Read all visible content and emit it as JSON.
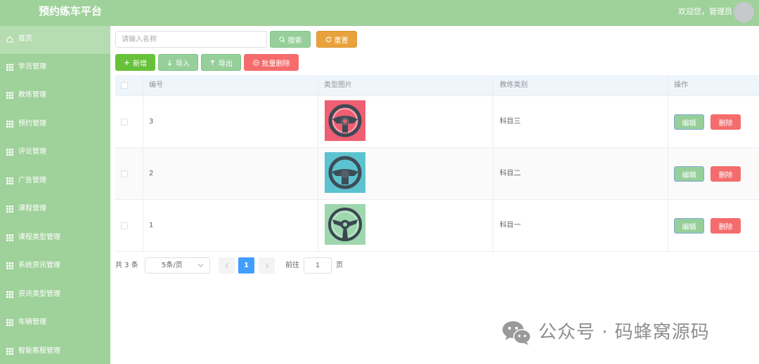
{
  "header": {
    "brand": "预约练车平台",
    "welcome": "欢迎您，管理员"
  },
  "sidebar": {
    "items": [
      {
        "label": "首页",
        "icon": "home-icon"
      },
      {
        "label": "学员管理",
        "icon": "grid-icon"
      },
      {
        "label": "教练管理",
        "icon": "grid-icon"
      },
      {
        "label": "预约管理",
        "icon": "grid-icon"
      },
      {
        "label": "评论管理",
        "icon": "grid-icon"
      },
      {
        "label": "广告管理",
        "icon": "grid-icon"
      },
      {
        "label": "课程管理",
        "icon": "grid-icon"
      },
      {
        "label": "课程类型管理",
        "icon": "grid-icon"
      },
      {
        "label": "系统资讯管理",
        "icon": "grid-icon"
      },
      {
        "label": "资讯类型管理",
        "icon": "grid-icon"
      },
      {
        "label": "车辆管理",
        "icon": "grid-icon"
      },
      {
        "label": "智能客服管理",
        "icon": "grid-icon"
      }
    ]
  },
  "toolbar": {
    "search_placeholder": "请输入名称",
    "search_label": "搜索",
    "reset_label": "重置",
    "add_label": "新增",
    "import_label": "导入",
    "export_label": "导出",
    "batch_delete_label": "批量删除"
  },
  "table": {
    "headers": {
      "number": "编号",
      "image": "类型图片",
      "category": "教练类别",
      "actions": "操作"
    },
    "rows": [
      {
        "number": "3",
        "category": "科目三",
        "image_icon": "steering-wheel-red-icon"
      },
      {
        "number": "2",
        "category": "科目二",
        "image_icon": "steering-wheel-teal-icon"
      },
      {
        "number": "1",
        "category": "科目一",
        "image_icon": "steering-wheel-green-icon"
      }
    ],
    "edit_label": "编辑",
    "delete_label": "删除"
  },
  "pagination": {
    "total": "共 3 条",
    "page_size": "5条/页",
    "current_page": "1",
    "goto_label": "前往",
    "goto_value": "1",
    "page_suffix": "页"
  },
  "watermark": {
    "text": "公众号 · 码蜂窝源码"
  },
  "colors": {
    "primary": "#9fd19a",
    "danger": "#f56c6c",
    "warning": "#e9a23b",
    "success": "#67c23a",
    "page_active": "#409eff"
  }
}
